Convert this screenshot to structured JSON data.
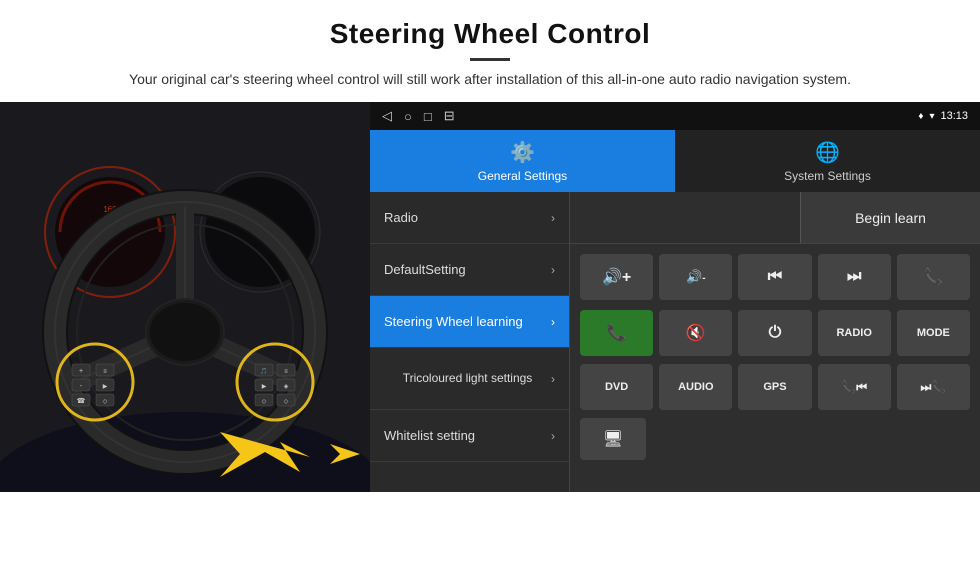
{
  "header": {
    "title": "Steering Wheel Control",
    "subtitle": "Your original car's steering wheel control will still work after installation of this all-in-one auto radio navigation system."
  },
  "status_bar": {
    "nav_icons": [
      "◁",
      "○",
      "□",
      "⊟"
    ],
    "right_icons": [
      "♦",
      "▾",
      "13:13"
    ]
  },
  "tabs": [
    {
      "id": "general",
      "label": "General Settings",
      "icon": "⚙",
      "active": true
    },
    {
      "id": "system",
      "label": "System Settings",
      "icon": "🌐",
      "active": false
    }
  ],
  "menu_items": [
    {
      "id": "radio",
      "label": "Radio",
      "active": false
    },
    {
      "id": "default",
      "label": "DefaultSetting",
      "active": false
    },
    {
      "id": "steering",
      "label": "Steering Wheel learning",
      "active": true
    },
    {
      "id": "tricoloured",
      "label": "Tricoloured light settings",
      "active": false,
      "tall": true
    },
    {
      "id": "whitelist",
      "label": "Whitelist setting",
      "active": false
    }
  ],
  "panel": {
    "begin_learn_label": "Begin learn",
    "buttons_row1": [
      {
        "label": "🔊+",
        "id": "vol-up"
      },
      {
        "label": "🔊-",
        "id": "vol-down"
      },
      {
        "label": "⏮",
        "id": "prev-track"
      },
      {
        "label": "⏭",
        "id": "next-track"
      },
      {
        "label": "📞",
        "id": "call"
      }
    ],
    "buttons_row2": [
      {
        "label": "📞",
        "id": "answer",
        "type": "answer"
      },
      {
        "label": "🔇",
        "id": "mute"
      },
      {
        "label": "⏻",
        "id": "power"
      },
      {
        "label": "RADIO",
        "id": "radio-btn",
        "text": true
      },
      {
        "label": "MODE",
        "id": "mode-btn",
        "text": true
      }
    ],
    "buttons_row3": [
      {
        "label": "DVD",
        "id": "dvd",
        "text": true
      },
      {
        "label": "AUDIO",
        "id": "audio",
        "text": true
      },
      {
        "label": "GPS",
        "id": "gps",
        "text": true
      },
      {
        "label": "📞⏮",
        "id": "call-prev"
      },
      {
        "label": "⏭📞",
        "id": "call-next"
      }
    ],
    "buttons_row4": [
      {
        "label": "🖥",
        "id": "screen"
      }
    ]
  }
}
